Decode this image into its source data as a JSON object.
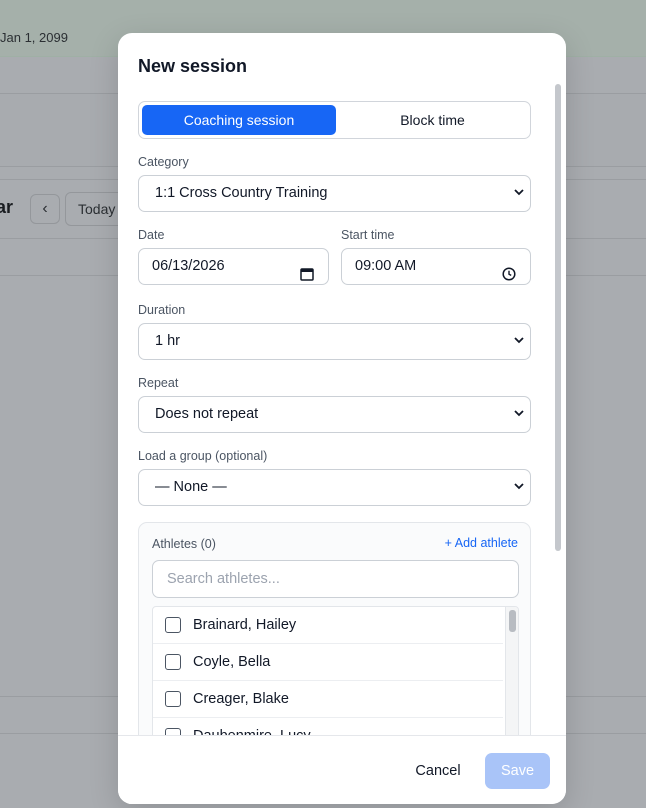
{
  "background": {
    "header_date": "Jan 1, 2099",
    "page_title": "ar",
    "prev_label": "‹",
    "today_label": "Today"
  },
  "modal": {
    "title": "New session",
    "segment": {
      "active": "Coaching session",
      "inactive": "Block time"
    },
    "category": {
      "label": "Category",
      "value": "1:1 Cross Country Training"
    },
    "date": {
      "label": "Date",
      "value": "06/13/2026"
    },
    "start_time": {
      "label": "Start time",
      "value": "09:00 AM"
    },
    "duration": {
      "label": "Duration",
      "value": "1 hr"
    },
    "repeat": {
      "label": "Repeat",
      "value": "Does not repeat"
    },
    "group": {
      "label": "Load a group (optional)",
      "value": "— None —"
    },
    "athletes": {
      "label": "Athletes (0)",
      "add_label": "+ Add athlete",
      "search_placeholder": "Search athletes...",
      "items": [
        {
          "name": "Brainard, Hailey",
          "checked": false
        },
        {
          "name": "Coyle, Bella",
          "checked": false
        },
        {
          "name": "Creager, Blake",
          "checked": false
        },
        {
          "name": "Daubenmire, Lucy",
          "checked": false
        }
      ]
    },
    "footer": {
      "cancel_label": "Cancel",
      "save_label": "Save"
    }
  },
  "colors": {
    "accent": "#1766f5",
    "save_disabled": "#a9c4f8",
    "overlay": "#a9acb0"
  }
}
